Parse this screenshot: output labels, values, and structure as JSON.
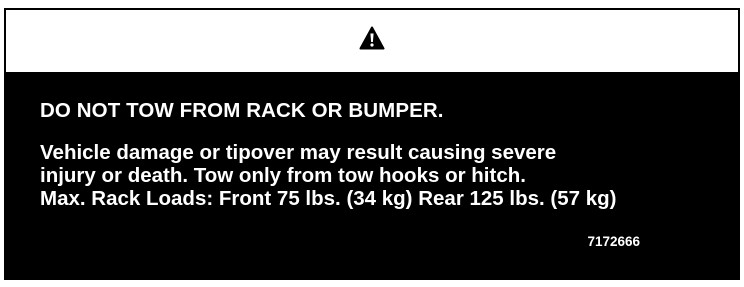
{
  "icon": {
    "name": "warning-triangle-icon",
    "color": "#000000"
  },
  "label": {
    "background": "#000000",
    "text_color": "#ffffff",
    "header_background": "#ffffff",
    "headline": "DO NOT TOW FROM RACK OR BUMPER.",
    "lines": [
      "Vehicle damage or tipover may result causing severe",
      "injury or death. Tow only from tow hooks or hitch.",
      "Max. Rack Loads: Front 75 lbs. (34 kg) Rear 125 lbs. (57 kg)"
    ],
    "part_number": "7172666"
  }
}
